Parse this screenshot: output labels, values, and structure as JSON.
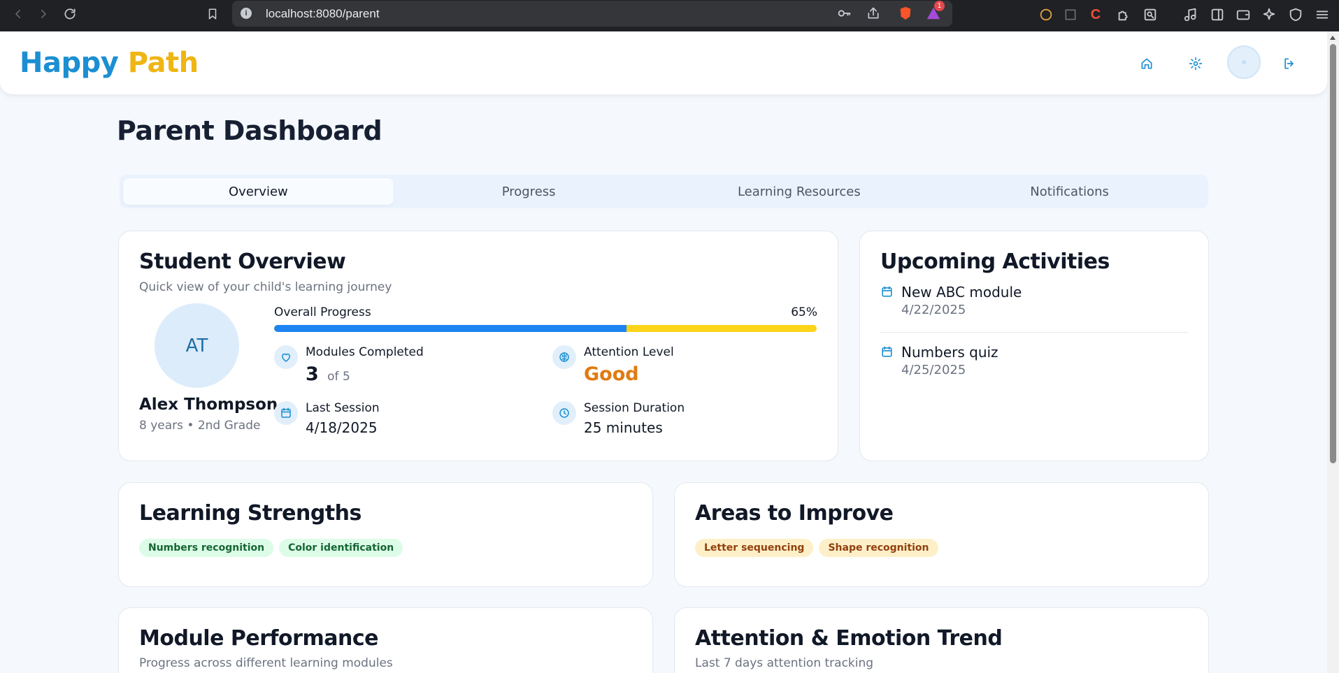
{
  "browser": {
    "url": "localhost:8080/parent",
    "extension_badge": "1"
  },
  "app": {
    "brand_first": "Happy",
    "brand_second": "Path",
    "colors": {
      "brand_blue": "#1b8fd1",
      "brand_yellow": "#efb514",
      "progress_blue": "#1d84f2",
      "progress_yellow": "#fcd419",
      "accent_orange": "#e07b12"
    },
    "header_icons": [
      "home-icon",
      "gear-icon",
      "avatar",
      "logout-icon"
    ]
  },
  "page": {
    "title": "Parent Dashboard"
  },
  "tabs": [
    {
      "label": "Overview",
      "active": true
    },
    {
      "label": "Progress",
      "active": false
    },
    {
      "label": "Learning Resources",
      "active": false
    },
    {
      "label": "Notifications",
      "active": false
    }
  ],
  "student_overview": {
    "title": "Student Overview",
    "subtitle": "Quick view of your child's learning journey",
    "initials": "AT",
    "name": "Alex Thompson",
    "meta": "8 years • 2nd Grade",
    "progress_label": "Overall Progress",
    "progress_text": "65%",
    "progress_value": 0.65,
    "stats": {
      "modules": {
        "label": "Modules Completed",
        "value": "3",
        "suffix": "of 5",
        "icon": "heart-icon"
      },
      "attention": {
        "label": "Attention Level",
        "value": "Good",
        "icon": "brain-icon"
      },
      "last_session": {
        "label": "Last Session",
        "value": "4/18/2025",
        "icon": "calendar-icon"
      },
      "duration": {
        "label": "Session Duration",
        "value": "25 minutes",
        "icon": "clock-icon"
      }
    }
  },
  "upcoming": {
    "title": "Upcoming Activities",
    "items": [
      {
        "title": "New ABC module",
        "date": "4/22/2025"
      },
      {
        "title": "Numbers quiz",
        "date": "4/25/2025"
      }
    ]
  },
  "strengths": {
    "title": "Learning Strengths",
    "chips": [
      "Numbers recognition",
      "Color identification"
    ]
  },
  "improve": {
    "title": "Areas to Improve",
    "chips": [
      "Letter sequencing",
      "Shape recognition"
    ]
  },
  "module_performance": {
    "title": "Module Performance",
    "subtitle": "Progress across different learning modules"
  },
  "attention_trend": {
    "title": "Attention & Emotion Trend",
    "subtitle": "Last 7 days attention tracking"
  }
}
